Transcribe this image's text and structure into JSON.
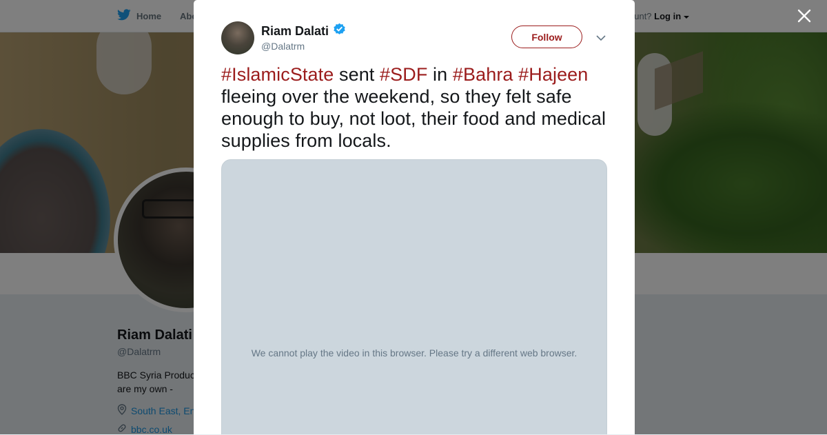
{
  "topbar": {
    "home_label": "Home",
    "about_label": "Abo",
    "account_prompt": "ccount?",
    "login_label": "Log in"
  },
  "profile": {
    "name": "Riam Dalati",
    "handle": "@Dalatrm",
    "bio": "BBC Syria Produc are my own -",
    "location": "South East, En",
    "website": "bbc.co.uk"
  },
  "tweet": {
    "author_name": "Riam Dalati",
    "author_handle": "@Dalatrm",
    "follow_label": "Follow",
    "text_segments": [
      {
        "text": "#IslamicState",
        "hashtag": true
      },
      {
        "text": " sent ",
        "hashtag": false
      },
      {
        "text": "#SDF",
        "hashtag": true
      },
      {
        "text": " in ",
        "hashtag": false
      },
      {
        "text": "#Bahra",
        "hashtag": true
      },
      {
        "text": " ",
        "hashtag": false
      },
      {
        "text": "#Hajeen",
        "hashtag": true
      },
      {
        "text": " fleeing over the weekend, so they felt safe enough to buy, not loot, their food and medical supplies from locals.",
        "hashtag": false
      }
    ],
    "video_message": "We cannot play the video in this browser. Please try a different web browser."
  },
  "colors": {
    "accent": "#9b1c1c",
    "verified": "#1da1f2",
    "video_bg": "#ccd6dd"
  },
  "icons": [
    "twitter-bird-icon",
    "caret-down-icon",
    "close-icon",
    "verified-icon",
    "chevron-down-icon",
    "location-pin-icon",
    "link-icon"
  ]
}
